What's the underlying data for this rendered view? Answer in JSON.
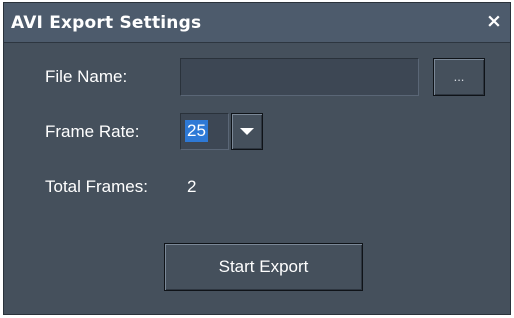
{
  "window": {
    "title": "AVI Export Settings",
    "close_symbol": "×"
  },
  "form": {
    "file_name_label": "File Name:",
    "file_name_value": "",
    "browse_label": "...",
    "frame_rate_label": "Frame Rate:",
    "frame_rate_value": "25",
    "total_frames_label": "Total Frames:",
    "total_frames_value": "2"
  },
  "actions": {
    "start_export_label": "Start Export"
  },
  "icons": {
    "close": "close-icon",
    "dropdown": "chevron-down-icon"
  },
  "colors": {
    "window_bg": "#45505c",
    "titlebar_bg": "#4d5b6c",
    "selection": "#2e79d6",
    "text": "#ffffff"
  }
}
